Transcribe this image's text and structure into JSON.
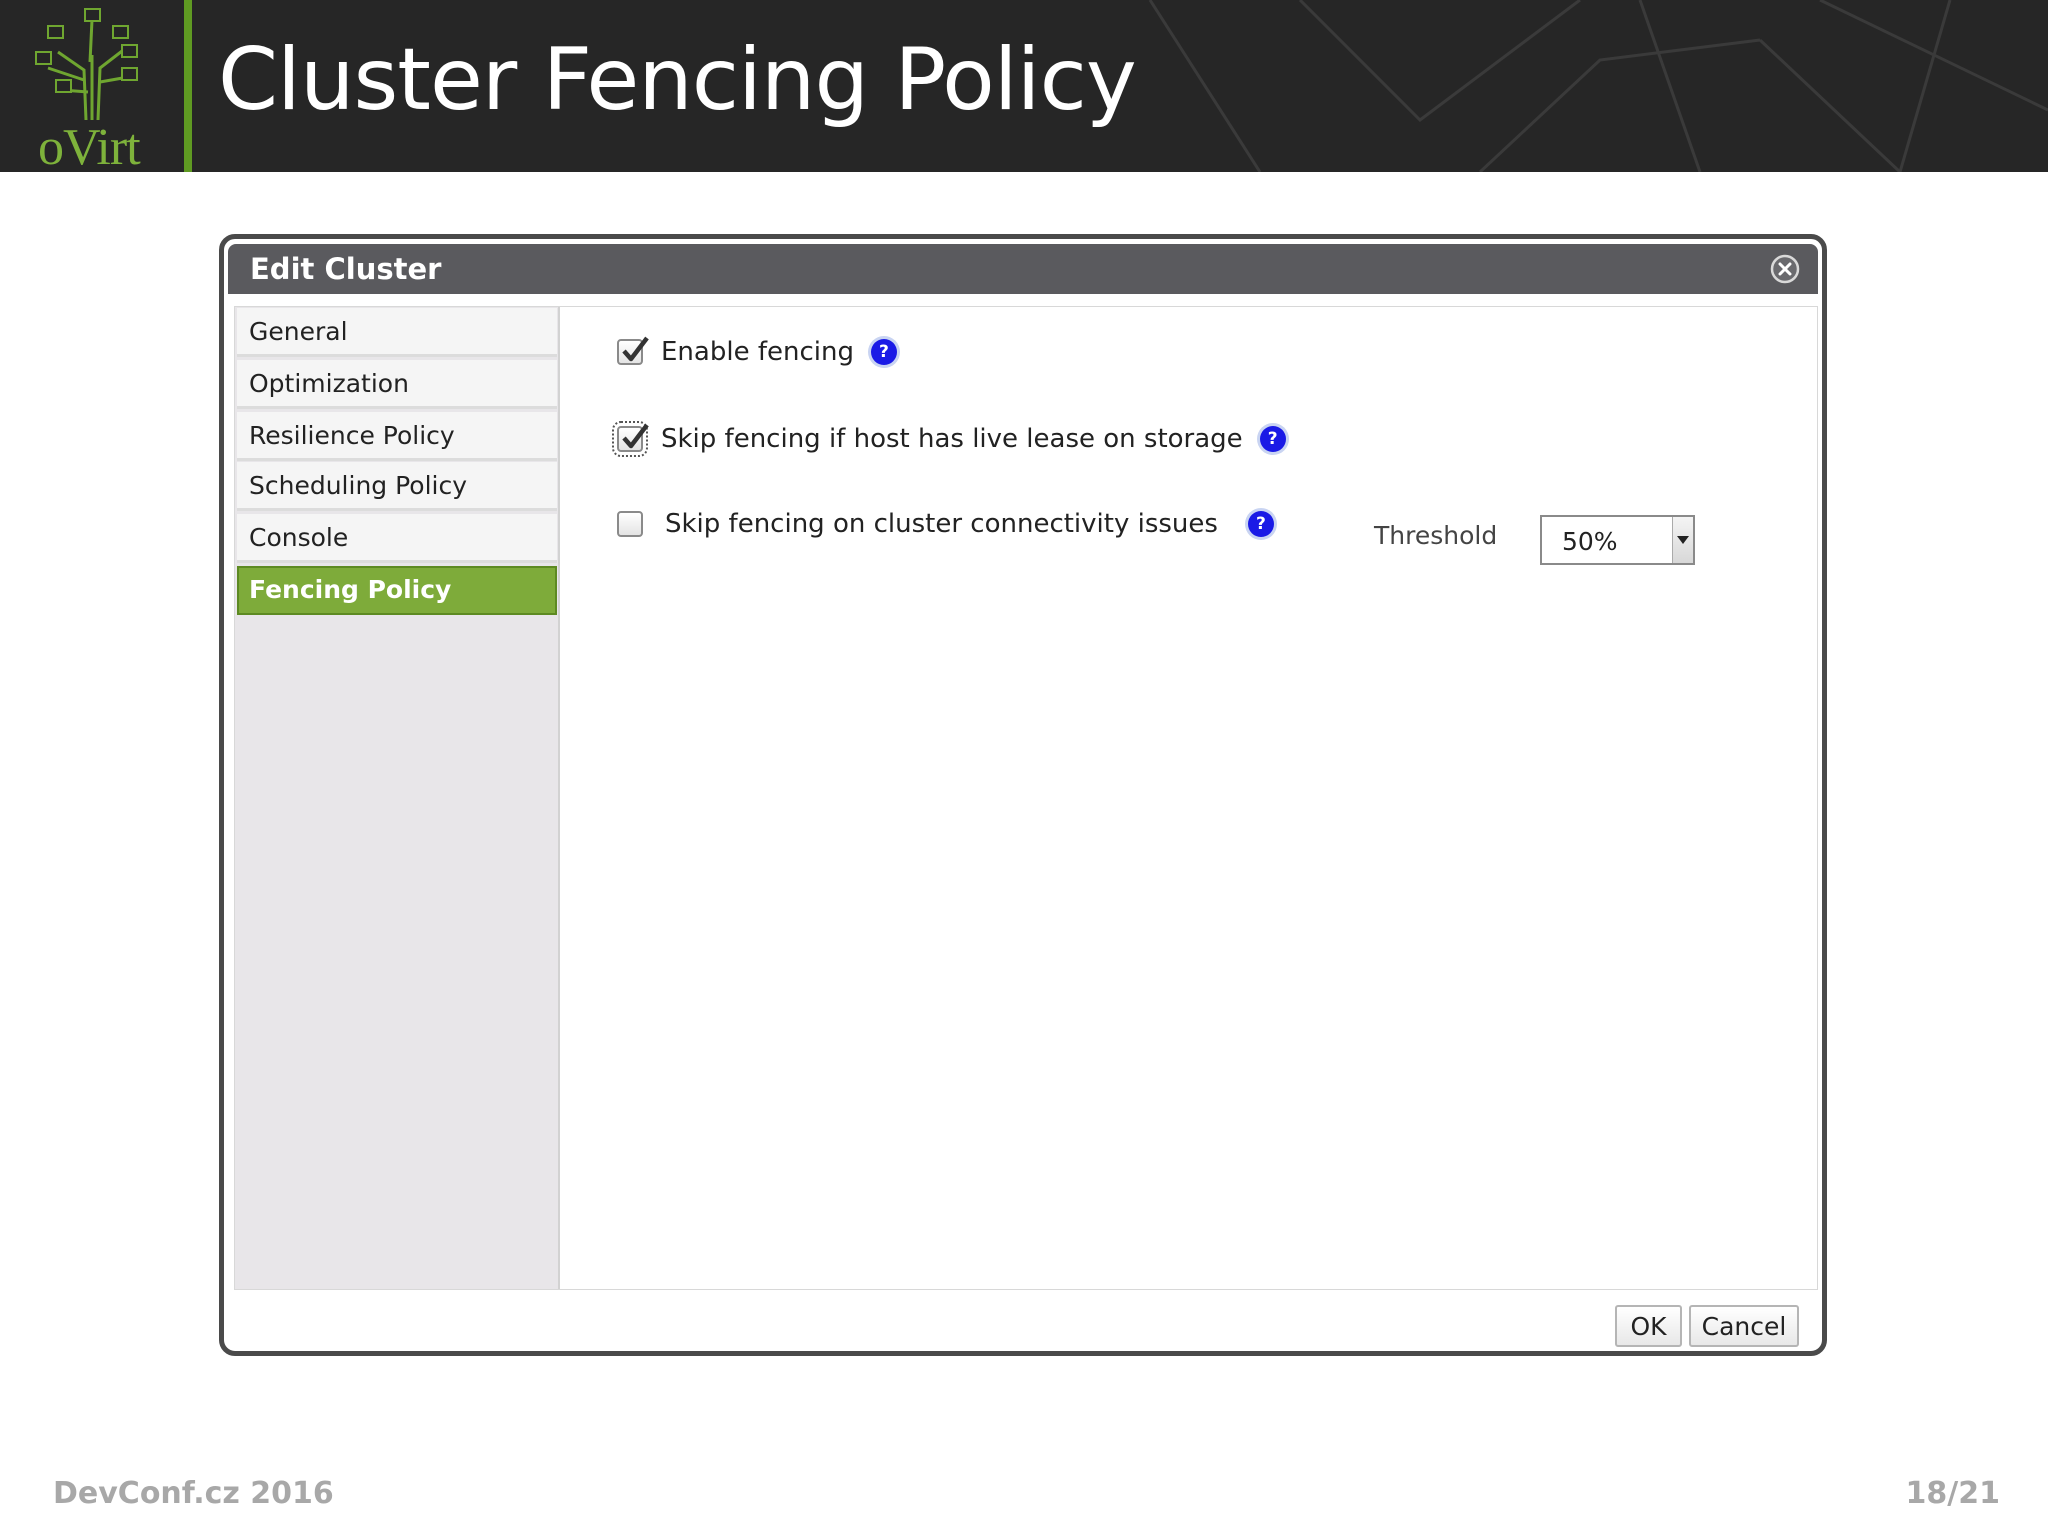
{
  "slide": {
    "title": "Cluster Fencing Policy",
    "logo_text": "oVirt",
    "footer_left": "DevConf.cz 2016",
    "footer_right": "18/21"
  },
  "colors": {
    "header_bg": "#262626",
    "brand_green": "#7eab3a",
    "help_blue": "#1a1ae6"
  },
  "dialog": {
    "title": "Edit Cluster",
    "close_icon": "close-icon",
    "nav": [
      {
        "label": "General",
        "active": false
      },
      {
        "label": "Optimization",
        "active": false
      },
      {
        "label": "Resilience Policy",
        "active": false
      },
      {
        "label": "Scheduling Policy",
        "active": false
      },
      {
        "label": "Console",
        "active": false
      },
      {
        "label": "Fencing Policy",
        "active": true
      }
    ],
    "fields": {
      "enable_fencing": {
        "label": "Enable fencing",
        "checked": true
      },
      "skip_fencing_lease": {
        "label": "Skip fencing if host has live lease on storage",
        "checked": true
      },
      "skip_fencing_connectivity": {
        "label": "Skip fencing on cluster connectivity issues",
        "checked": false
      },
      "threshold": {
        "label": "Threshold",
        "value": "50%"
      }
    },
    "help_glyph": "?",
    "buttons": {
      "ok": "OK",
      "cancel": "Cancel"
    }
  }
}
